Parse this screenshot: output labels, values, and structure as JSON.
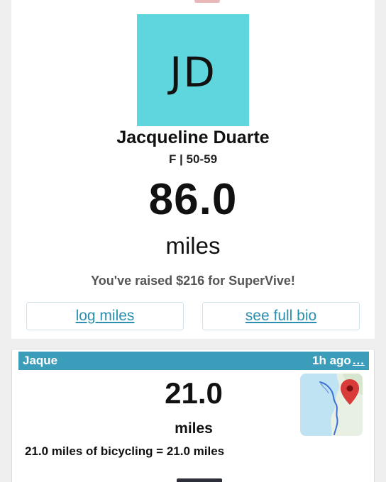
{
  "profile": {
    "initials": "JD",
    "avatar_color": "#5fd6dd",
    "name": "Jacqueline Duarte",
    "demographic": "F | 50-59",
    "total_miles": "86.0",
    "unit": "miles",
    "raised_text": "You've raised $216 for SuperVive!"
  },
  "actions": {
    "log_label": "log miles",
    "bio_label": "see full bio"
  },
  "activity": {
    "user": "Jaque",
    "time": "1h ago",
    "more": "...",
    "miles": "21.0",
    "unit": "miles",
    "description": "21.0 miles of bicycling = 21.0 miles",
    "map_icon": "map-pin-icon"
  },
  "colors": {
    "accent": "#3b9db9",
    "link": "#2c8fb0",
    "pin": "#d93a3a"
  }
}
